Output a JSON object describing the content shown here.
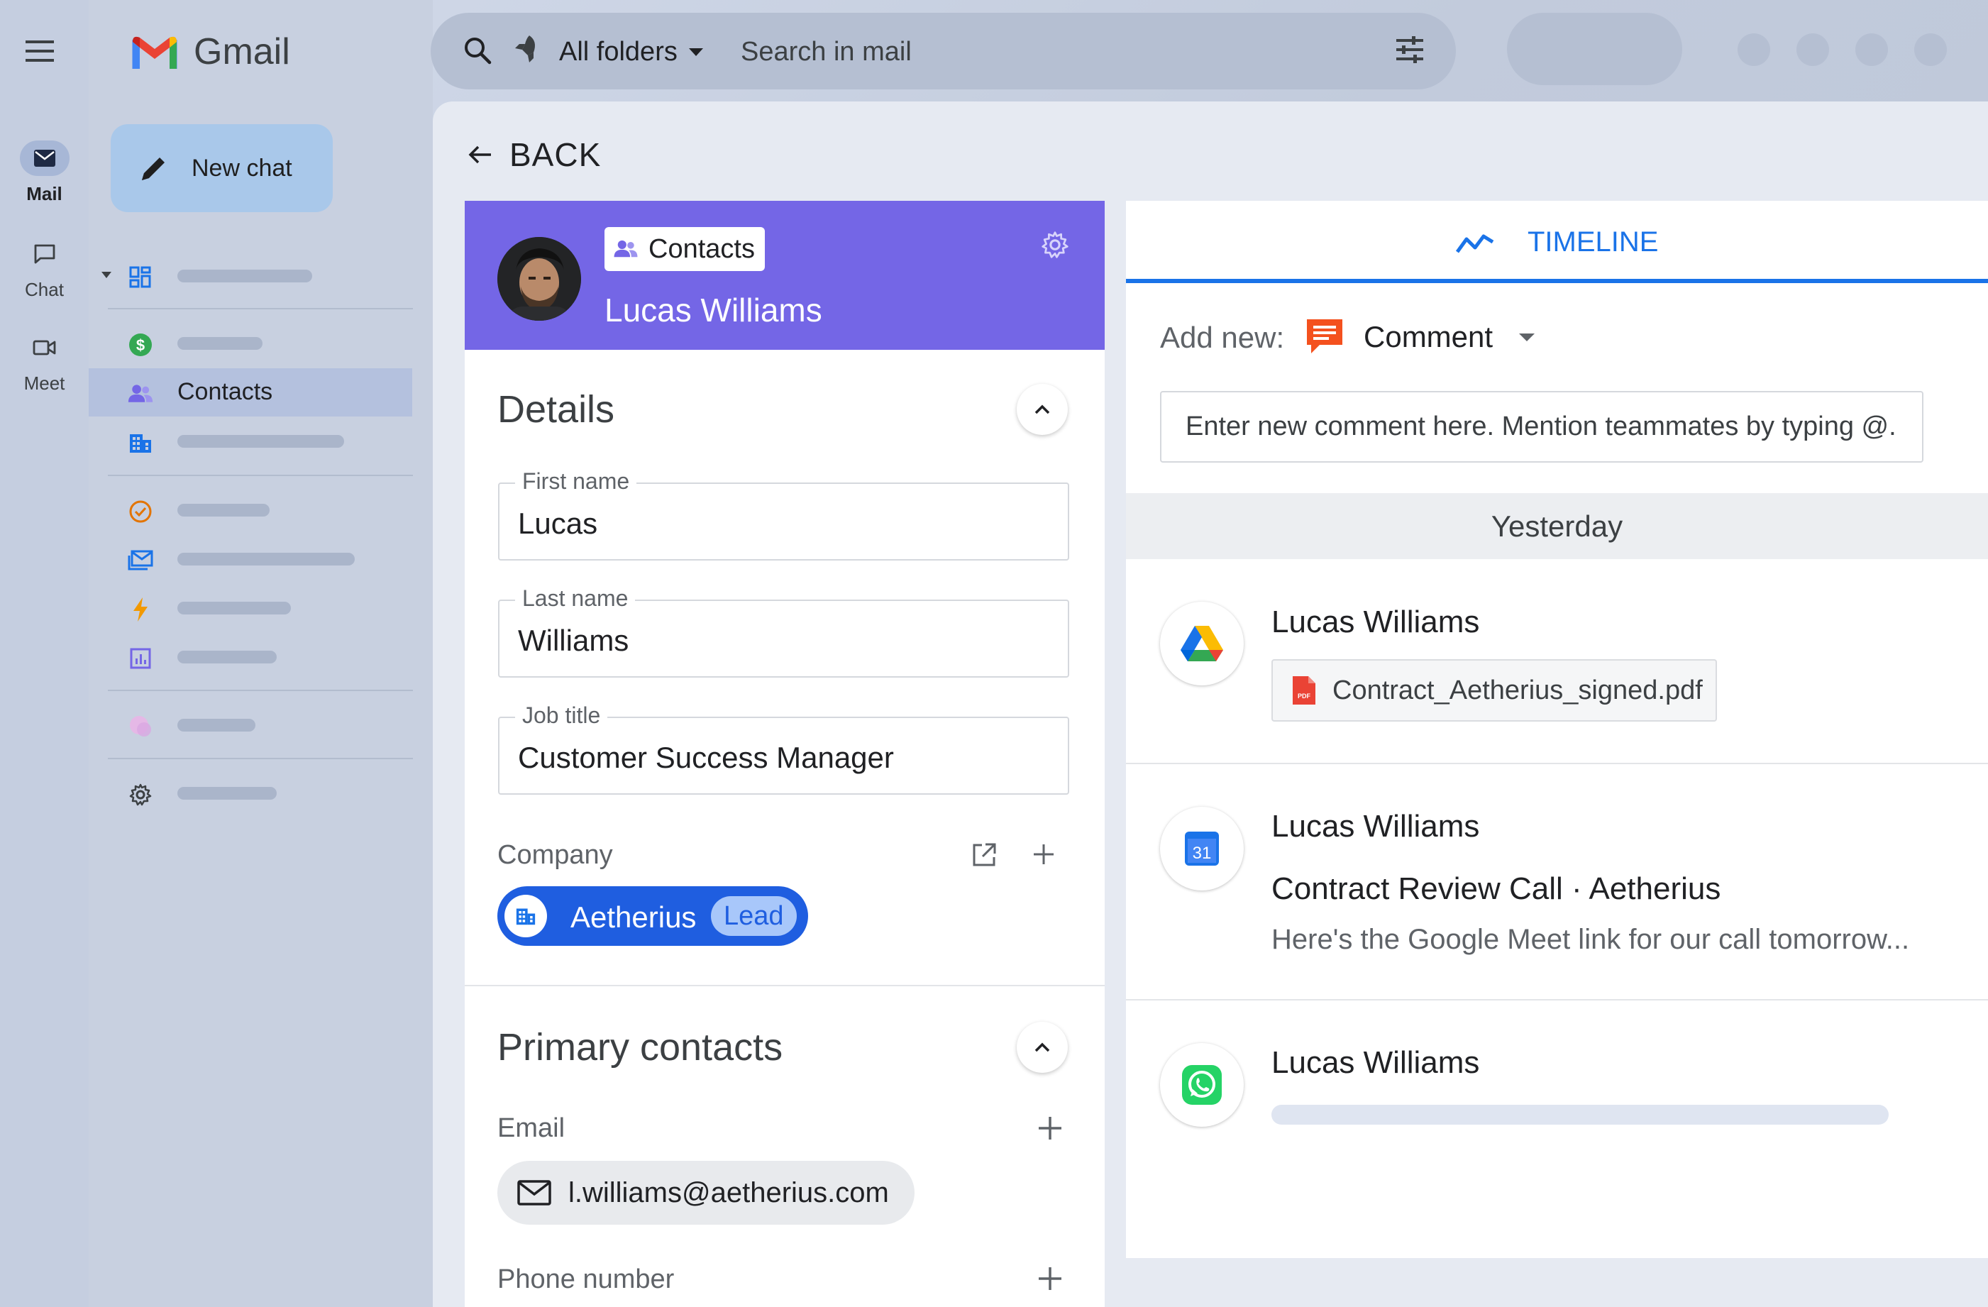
{
  "rail": {
    "items": [
      {
        "label": "Mail",
        "icon": "mail-icon",
        "active": true
      },
      {
        "label": "Chat",
        "icon": "chat-icon",
        "active": false
      },
      {
        "label": "Meet",
        "icon": "video-icon",
        "active": false
      }
    ]
  },
  "app": {
    "name": "Gmail"
  },
  "sidebar": {
    "new_chat_label": "New chat",
    "contacts_label": "Contacts"
  },
  "search": {
    "folder_label": "All folders",
    "placeholder": "Search in mail"
  },
  "main": {
    "back_label": "BACK"
  },
  "contact": {
    "badge_label": "Contacts",
    "full_name": "Lucas Williams"
  },
  "details": {
    "title": "Details",
    "fields": {
      "first_name": {
        "label": "First name",
        "value": "Lucas"
      },
      "last_name": {
        "label": "Last name",
        "value": "Williams"
      },
      "job_title": {
        "label": "Job title",
        "value": "Customer Success Manager"
      }
    },
    "company_label": "Company",
    "company_chip": {
      "name": "Aetherius",
      "status": "Lead"
    }
  },
  "primary_contacts": {
    "title": "Primary contacts",
    "email_label": "Email",
    "email_value": "l.williams@aetherius.com",
    "phone_label": "Phone number"
  },
  "timeline": {
    "tab_label": "TIMELINE",
    "add_new_label": "Add new:",
    "add_type": "Comment",
    "comment_placeholder": "Enter new comment here. Mention teammates by typing @...",
    "day_header": "Yesterday",
    "entries": [
      {
        "source": "google-drive",
        "author": "Lucas Williams",
        "attachment": "Contract_Aetherius_signed.pdf"
      },
      {
        "source": "google-calendar",
        "author": "Lucas Williams",
        "title": "Contract Review Call · Aetherius",
        "snippet": "Here's the Google Meet link for our call tomorrow..."
      },
      {
        "source": "whatsapp",
        "author": "Lucas Williams"
      }
    ],
    "calendar_day": "31"
  },
  "colors": {
    "header_purple": "#7466e6",
    "accent_blue": "#1a73e8",
    "chip_blue": "#1f5ee0",
    "comment_orange": "#f4511e"
  }
}
